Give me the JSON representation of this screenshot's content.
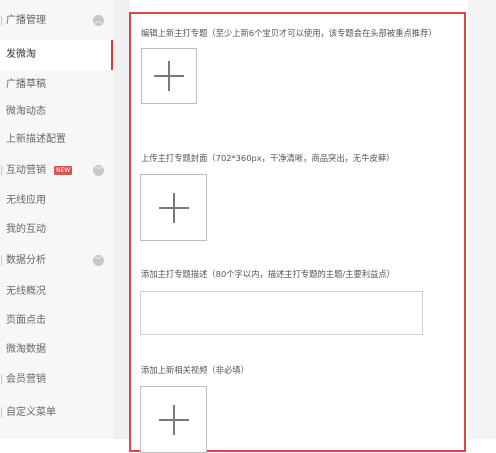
{
  "sidebar": {
    "items": [
      {
        "label": "广播管理",
        "chevron": "up"
      },
      {
        "label": "发微淘",
        "active": true
      },
      {
        "label": "广播草稿"
      },
      {
        "label": "微淘动态"
      },
      {
        "label": "上新描述配置"
      },
      {
        "label": "互动营销",
        "badge": "NEW",
        "chevron": "down"
      },
      {
        "label": "无线应用"
      },
      {
        "label": "我的互动"
      },
      {
        "label": "数据分析",
        "chevron": "down"
      },
      {
        "label": "无线概况"
      },
      {
        "label": "页面点击"
      },
      {
        "label": "微淘数据"
      },
      {
        "label": "会员营销"
      },
      {
        "label": "自定义菜单"
      }
    ]
  },
  "form": {
    "sections": [
      {
        "label": "编辑上新主打专题（至少上新6个宝贝才可以使用，该专题会在头部被重点推荐）"
      },
      {
        "label": "上传主打专题封面（702*360px，干净清晰，商品突出，无牛皮藓）"
      },
      {
        "label": "添加主打专题描述（80个字以内，描述主打专题的主题/主要利益点）"
      },
      {
        "label": "添加上新相关视频（非必填）"
      }
    ]
  },
  "icons": {
    "upload": "plus-icon",
    "expand": "chevron-icon"
  },
  "colors": {
    "accent": "#e04646",
    "badge": "#e0534d"
  }
}
